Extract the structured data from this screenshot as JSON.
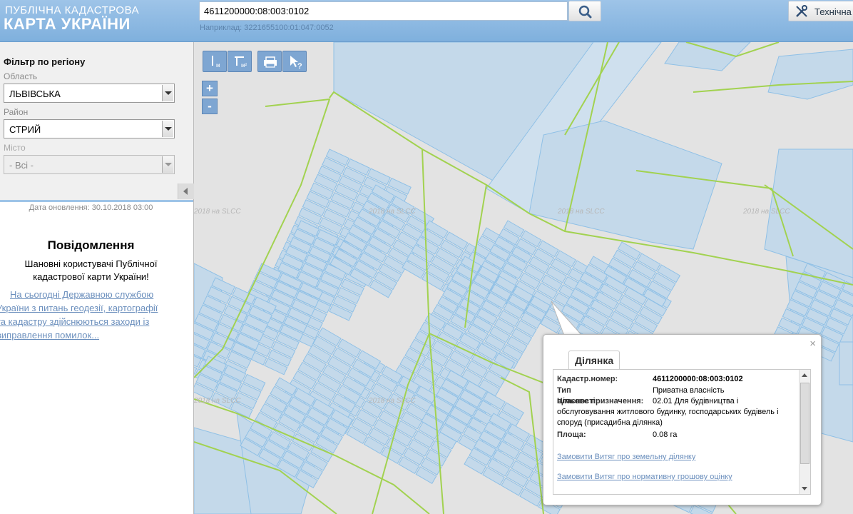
{
  "header": {
    "logo_line1": "ПУБЛІЧНА КАДАСТРОВА",
    "logo_line2": "КАРТА УКРАЇНИ",
    "search_value": "4611200000:08:003:0102",
    "search_icon": "search-icon",
    "example_text": "Наприклад: 3221655100:01:047:0052",
    "tech_button_label": "Технічна",
    "tech_icon": "tools-icon"
  },
  "sidebar": {
    "filter_title": "Фільтр по регіону",
    "oblast_label": "Область",
    "oblast_value": "ЛЬВІВСЬКА",
    "raion_label": "Район",
    "raion_value": "СТРИЙ",
    "misto_label": "Місто",
    "misto_value": "- Всі -",
    "update_date": "Дата оновлення: 30.10.2018 03:00",
    "notice_title": "Повідомлення",
    "notice_greeting_1": "Шановні користувачі Публічної",
    "notice_greeting_2": "кадастрової карти України!",
    "notice_link_lines": [
      "На сьогодні Державною службою",
      "України з питань геодезії, картографії",
      "та кадастру здійснюються заходи із",
      "виправлення помилок..."
    ]
  },
  "map": {
    "toolbar": [
      {
        "name": "measure-distance-button",
        "icon": "ruler-icon",
        "sub": "м"
      },
      {
        "name": "measure-area-button",
        "icon": "area-icon",
        "sub": "м²"
      },
      {
        "name": "print-button",
        "icon": "printer-icon"
      },
      {
        "name": "identify-button",
        "icon": "cursor-question-icon"
      }
    ],
    "zoom_in": "+",
    "zoom_out": "-",
    "watermark": "2018 на SLCC"
  },
  "popup": {
    "tab_label": "Ділянка",
    "rows": [
      {
        "key": "Кадастр.номер:",
        "value": "4611200000:08:003:0102"
      },
      {
        "key": "Тип власності:",
        "value": "Приватна власність"
      },
      {
        "key": "Цільове призначення:",
        "value": "02.01 Для будівництва і обслуговування житлового будинку, господарських будівель і споруд (присадибна ділянка)"
      },
      {
        "key": "Площа:",
        "value": "0.08 га"
      }
    ],
    "purpose_lines": [
      "02.01 Для будівництва і",
      "обслуговування житлового будинку, господарських будівель і",
      "споруд (присадибна ділянка)"
    ],
    "link1": "Замовити Витяг про земельну ділянку",
    "link2": "Замовити Витяг про нормативну грошову оцінку",
    "close": "×"
  },
  "colors": {
    "header": "#8fb9e2",
    "parcel_fill": "#c4d9ea",
    "parcel_stroke": "#8fc0e6",
    "boundary": "#9fd24a",
    "link": "#6b8fbd"
  }
}
